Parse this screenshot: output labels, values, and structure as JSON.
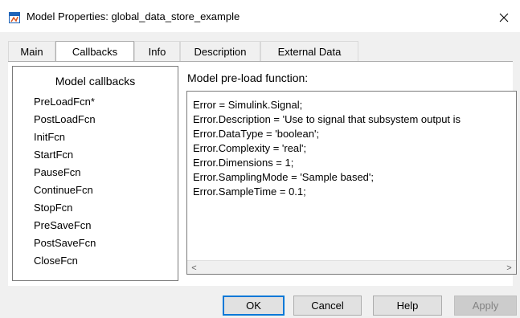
{
  "window": {
    "title": "Model Properties: global_data_store_example",
    "close_glyph": "✕"
  },
  "tabs": [
    {
      "label": "Main"
    },
    {
      "label": "Callbacks"
    },
    {
      "label": "Info"
    },
    {
      "label": "Description"
    },
    {
      "label": "External Data"
    }
  ],
  "active_tab": "Callbacks",
  "callbacks": {
    "header": "Model callbacks",
    "items": [
      "PreLoadFcn*",
      "PostLoadFcn",
      "InitFcn",
      "StartFcn",
      "PauseFcn",
      "ContinueFcn",
      "StopFcn",
      "PreSaveFcn",
      "PostSaveFcn",
      "CloseFcn"
    ],
    "selected": "PreLoadFcn*"
  },
  "editor": {
    "label": "Model pre-load function:",
    "lines": [
      "Error = Simulink.Signal;",
      "Error.Description = 'Use to signal that subsystem output is",
      "Error.DataType = 'boolean';",
      "Error.Complexity = 'real';",
      "Error.Dimensions = 1;",
      "Error.SamplingMode = 'Sample based';",
      "Error.SampleTime = 0.1;"
    ],
    "scroll_left_glyph": "<",
    "scroll_right_glyph": ">"
  },
  "buttons": {
    "ok": "OK",
    "cancel": "Cancel",
    "help": "Help",
    "apply": "Apply"
  },
  "colors": {
    "default_button_border": "#0078d7",
    "app_icon": "#1e63b8"
  },
  "icons": {
    "app": "simulink-model-icon",
    "close": "close-icon"
  }
}
